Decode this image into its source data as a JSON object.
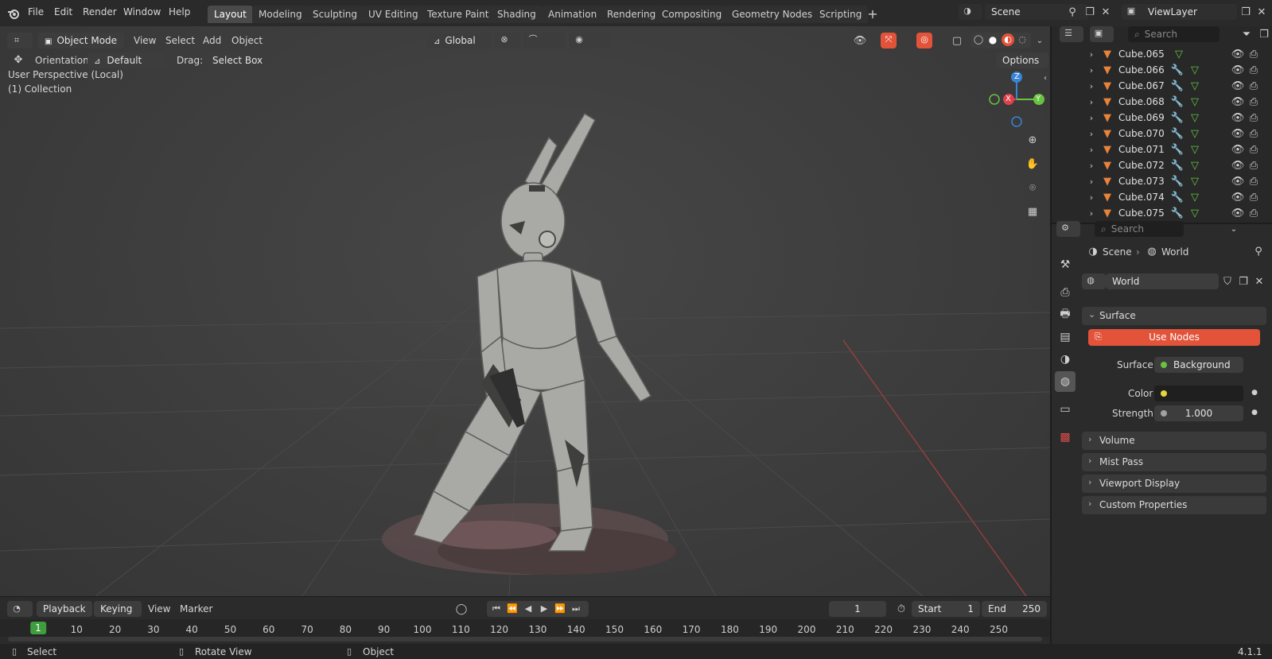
{
  "menu": {
    "file": "File",
    "edit": "Edit",
    "render": "Render",
    "window": "Window",
    "help": "Help"
  },
  "workspaces": [
    "Layout",
    "Modeling",
    "Sculpting",
    "UV Editing",
    "Texture Paint",
    "Shading",
    "Animation",
    "Rendering",
    "Compositing",
    "Geometry Nodes",
    "Scripting"
  ],
  "scene": {
    "name": "Scene",
    "view_layer": "ViewLayer"
  },
  "viewport_header": {
    "mode": "Object Mode",
    "view": "View",
    "select": "Select",
    "add": "Add",
    "object": "Object",
    "orientation_global": "Global",
    "orientation_label": "Orientation:",
    "orientation_value": "Default",
    "drag_label": "Drag:",
    "drag_value": "Select Box",
    "options": "Options"
  },
  "viewport_info": {
    "line1": "User Perspective (Local)",
    "line2": "(1) Collection"
  },
  "gizmo": {
    "z": "Z",
    "x": "X",
    "y": "Y"
  },
  "outliner": {
    "search_placeholder": "Search",
    "items": [
      "Cube.065",
      "Cube.066",
      "Cube.067",
      "Cube.068",
      "Cube.069",
      "Cube.070",
      "Cube.071",
      "Cube.072",
      "Cube.073",
      "Cube.074",
      "Cube.075"
    ]
  },
  "properties": {
    "search_placeholder": "Search",
    "breadcrumb_scene": "Scene",
    "breadcrumb_world": "World",
    "world_name": "World",
    "surface_panel": "Surface",
    "use_nodes": "Use Nodes",
    "surface_label": "Surface",
    "surface_value": "Background",
    "color_label": "Color",
    "strength_label": "Strength",
    "strength_value": "1.000",
    "panels": [
      "Volume",
      "Mist Pass",
      "Viewport Display",
      "Custom Properties"
    ]
  },
  "timeline": {
    "playback": "Playback",
    "keying": "Keying",
    "view": "View",
    "marker": "Marker",
    "current_frame": "1",
    "start_label": "Start",
    "start_value": "1",
    "end_label": "End",
    "end_value": "250",
    "ticks": [
      "1",
      "10",
      "20",
      "30",
      "40",
      "50",
      "60",
      "70",
      "80",
      "90",
      "100",
      "110",
      "120",
      "130",
      "140",
      "150",
      "160",
      "170",
      "180",
      "190",
      "200",
      "210",
      "220",
      "230",
      "240",
      "250"
    ]
  },
  "status": {
    "select": "Select",
    "rotate_view": "Rotate View",
    "object": "Object",
    "version": "4.1.1"
  },
  "colors": {
    "accent": "#e2533a",
    "active_frame": "#3e9e3e",
    "x_axis": "#e0404b",
    "y_axis": "#6ac243",
    "z_axis": "#3b83d6"
  }
}
